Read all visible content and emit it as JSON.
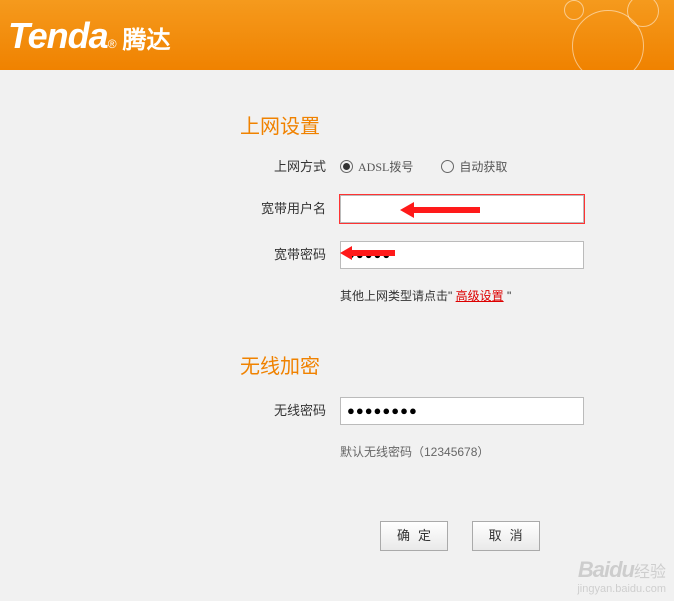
{
  "header": {
    "logo_en": "Tenda",
    "tm": "®",
    "logo_cn": "腾达"
  },
  "internet": {
    "title": "上网设置",
    "conn_label": "上网方式",
    "radio_adsl": "ADSL拨号",
    "radio_dhcp": "自动获取",
    "user_label": "宽带用户名",
    "user_value": "",
    "pass_label": "宽带密码",
    "pass_value": "●●●●●",
    "note_prefix": "其他上网类型请点击\"",
    "note_link": "高级设置",
    "note_suffix": "\""
  },
  "wireless": {
    "title": "无线加密",
    "pass_label": "无线密码",
    "pass_value": "●●●●●●●●",
    "hint": "默认无线密码（12345678）"
  },
  "buttons": {
    "ok": "确定",
    "cancel": "取消"
  },
  "watermark": {
    "brand": "Baidu",
    "cn": "经验",
    "url": "jingyan.baidu.com"
  }
}
